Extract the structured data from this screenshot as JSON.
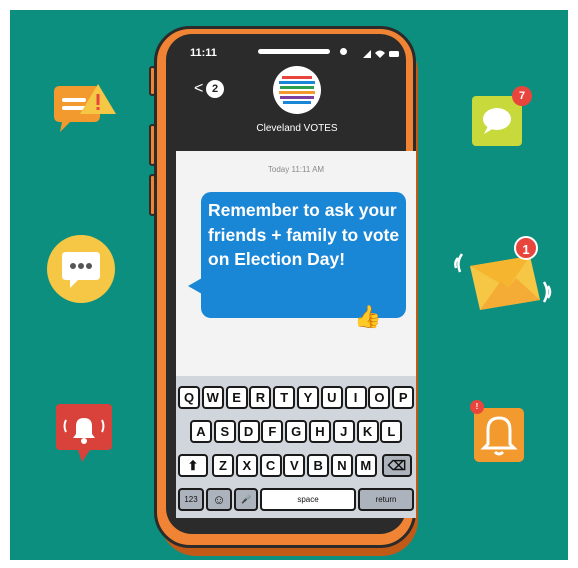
{
  "status": {
    "time": "11:11",
    "icons": "▲ ◆ ▬"
  },
  "header": {
    "back_glyph": "<",
    "unread_count": "2",
    "contact_name": "Cleveland VOTES"
  },
  "thread": {
    "timestamp": "Today 11:11 AM",
    "message": "Remember to ask your friends + family to vote on Election Day!",
    "reaction": "👍"
  },
  "keyboard": {
    "row1": [
      "Q",
      "W",
      "E",
      "R",
      "T",
      "Y",
      "U",
      "I",
      "O",
      "P"
    ],
    "row2": [
      "A",
      "S",
      "D",
      "F",
      "G",
      "H",
      "J",
      "K",
      "L"
    ],
    "row3": [
      "Z",
      "X",
      "C",
      "V",
      "B",
      "N",
      "M"
    ],
    "numbers_label": "123",
    "emoji_label": "☺",
    "mic_label": "🎤",
    "space_label": "space",
    "return_label": "return",
    "shift_label": "⬆",
    "delete_label": "⌫"
  },
  "notifications": {
    "message_badge": "7",
    "mail_badge": "1",
    "bell_badge": "!"
  },
  "colors": {
    "background": "#0d8f80",
    "phone": "#f08434",
    "bubble": "#1a86d6",
    "badge": "#e8453c"
  }
}
